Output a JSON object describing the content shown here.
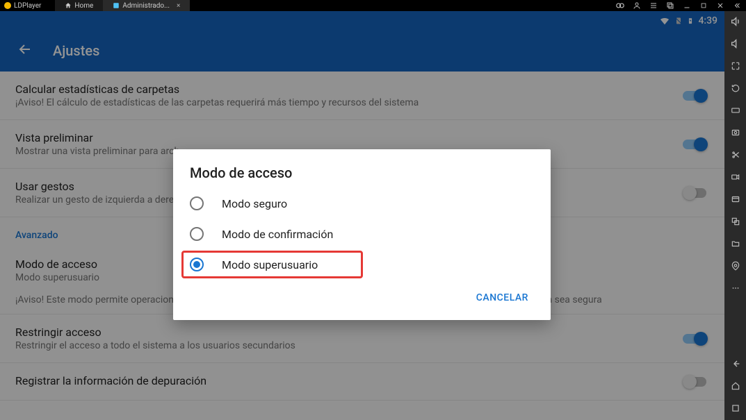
{
  "titlebar": {
    "app_name": "LDPlayer",
    "tabs": [
      {
        "label": "Home"
      },
      {
        "label": "Administrado..."
      }
    ]
  },
  "status": {
    "time": "4:39"
  },
  "appbar": {
    "title": "Ajustes"
  },
  "settings": {
    "folder_stats": {
      "title": "Calcular estadísticas de carpetas",
      "sub": "¡Aviso! El cálculo de estadísticas de las carpetas requerirá más tiempo y recursos del sistema",
      "on": true
    },
    "preview": {
      "title": "Vista preliminar",
      "sub": "Mostrar una vista preliminar para arch",
      "on": true
    },
    "gestures": {
      "title": "Usar gestos",
      "sub": "Realizar un gesto de izquierda a dere",
      "on": false
    },
    "section_advanced": "Avanzado",
    "access_mode": {
      "title": "Modo de acceso",
      "sub": "Modo superusuario"
    },
    "access_warning": "¡Aviso! Este modo permite operaciones que pueden bloquear el dispositivo. Eres responsable de asegurarte que la operación sea segura",
    "restrict": {
      "title": "Restringir acceso",
      "sub": "Restringir el acceso a todo el sistema a los usuarios secundarios",
      "on": true
    },
    "debug": {
      "title": "Registrar la información de depuración",
      "on": false
    }
  },
  "dialog": {
    "title": "Modo de acceso",
    "options": [
      {
        "label": "Modo seguro",
        "checked": false
      },
      {
        "label": "Modo de confirmación",
        "checked": false
      },
      {
        "label": "Modo superusuario",
        "checked": true
      }
    ],
    "cancel": "CANCELAR"
  }
}
